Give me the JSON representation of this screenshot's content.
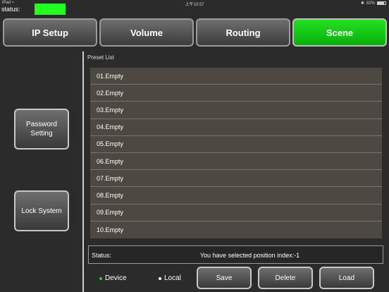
{
  "sysbar": {
    "device": "iPad",
    "time": "上午10:57",
    "battery": "82%",
    "battery_level": 0.82
  },
  "status": {
    "label": "status:",
    "color": "#22ff22"
  },
  "tabs": [
    {
      "label": "IP Setup",
      "active": false
    },
    {
      "label": "Volume",
      "active": false
    },
    {
      "label": "Routing",
      "active": false
    },
    {
      "label": "Scene",
      "active": true
    }
  ],
  "side": {
    "password_label": "Password\nSetting",
    "lock_label": "Lock System"
  },
  "preset": {
    "title": "Preset List",
    "items": [
      "01.Empty",
      "02.Empty",
      "03.Empty",
      "04.Empty",
      "05.Empty",
      "06.Empty",
      "07.Empty",
      "08.Empty",
      "09.Empty",
      "10.Empty"
    ]
  },
  "statusbar": {
    "label": "Status:",
    "message": "You have selected position index:-1"
  },
  "radios": [
    {
      "label": "Device",
      "selected": true,
      "dot_color": "#2ecc2e"
    },
    {
      "label": "Local",
      "selected": false,
      "dot_color": "#ffffff"
    }
  ],
  "actions": {
    "save": "Save",
    "delete": "Delete",
    "load": "Load"
  }
}
